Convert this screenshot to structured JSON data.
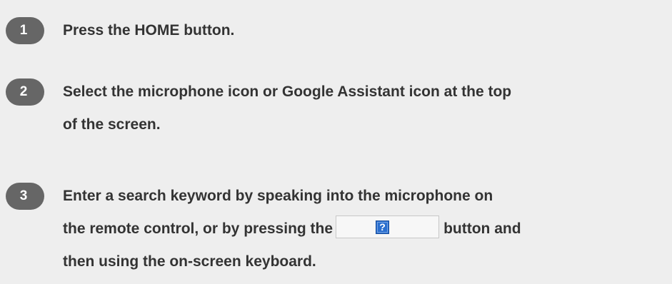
{
  "steps": [
    {
      "number": "1",
      "text": "Press the HOME button."
    },
    {
      "number": "2",
      "text_line1": "Select the microphone icon or Google Assistant icon at the top",
      "text_line2": "of the screen."
    },
    {
      "number": "3",
      "text_line1": "Enter a search keyword by speaking into the microphone on",
      "text_before_button": "the remote control, or by pressing the",
      "button_icon": "help-icon",
      "button_glyph": "?",
      "text_after_button": "button and",
      "text_line3": "then using the on-screen keyboard."
    }
  ],
  "colors": {
    "background": "#eeeeee",
    "badge": "#666666",
    "text": "#333333",
    "icon_blue": "#2a6fcf"
  }
}
